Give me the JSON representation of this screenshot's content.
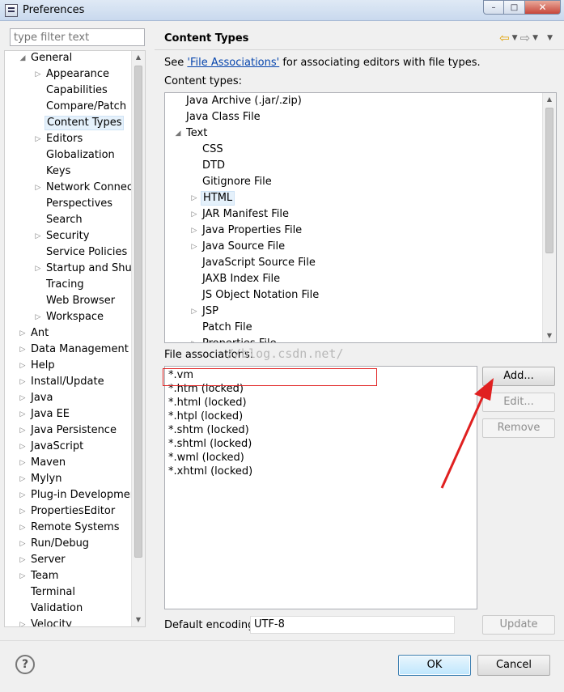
{
  "window": {
    "title": "Preferences",
    "minimize_glyph": "–",
    "maximize_glyph": "□",
    "close_glyph": "✕"
  },
  "filter": {
    "placeholder": "type filter text"
  },
  "left_tree": [
    {
      "label": "General",
      "level": 0,
      "arrow": "expanded"
    },
    {
      "label": "Appearance",
      "level": 1,
      "arrow": "collapsed"
    },
    {
      "label": "Capabilities",
      "level": 1,
      "arrow": "none"
    },
    {
      "label": "Compare/Patch",
      "level": 1,
      "arrow": "none"
    },
    {
      "label": "Content Types",
      "level": 1,
      "arrow": "none",
      "selected": true
    },
    {
      "label": "Editors",
      "level": 1,
      "arrow": "collapsed"
    },
    {
      "label": "Globalization",
      "level": 1,
      "arrow": "none"
    },
    {
      "label": "Keys",
      "level": 1,
      "arrow": "none"
    },
    {
      "label": "Network Connecti",
      "level": 1,
      "arrow": "collapsed"
    },
    {
      "label": "Perspectives",
      "level": 1,
      "arrow": "none"
    },
    {
      "label": "Search",
      "level": 1,
      "arrow": "none"
    },
    {
      "label": "Security",
      "level": 1,
      "arrow": "collapsed"
    },
    {
      "label": "Service Policies",
      "level": 1,
      "arrow": "none"
    },
    {
      "label": "Startup and Shutd",
      "level": 1,
      "arrow": "collapsed"
    },
    {
      "label": "Tracing",
      "level": 1,
      "arrow": "none"
    },
    {
      "label": "Web Browser",
      "level": 1,
      "arrow": "none"
    },
    {
      "label": "Workspace",
      "level": 1,
      "arrow": "collapsed"
    },
    {
      "label": "Ant",
      "level": 0,
      "arrow": "collapsed"
    },
    {
      "label": "Data Management",
      "level": 0,
      "arrow": "collapsed"
    },
    {
      "label": "Help",
      "level": 0,
      "arrow": "collapsed"
    },
    {
      "label": "Install/Update",
      "level": 0,
      "arrow": "collapsed"
    },
    {
      "label": "Java",
      "level": 0,
      "arrow": "collapsed"
    },
    {
      "label": "Java EE",
      "level": 0,
      "arrow": "collapsed"
    },
    {
      "label": "Java Persistence",
      "level": 0,
      "arrow": "collapsed"
    },
    {
      "label": "JavaScript",
      "level": 0,
      "arrow": "collapsed"
    },
    {
      "label": "Maven",
      "level": 0,
      "arrow": "collapsed"
    },
    {
      "label": "Mylyn",
      "level": 0,
      "arrow": "collapsed"
    },
    {
      "label": "Plug-in Development",
      "level": 0,
      "arrow": "collapsed"
    },
    {
      "label": "PropertiesEditor",
      "level": 0,
      "arrow": "collapsed"
    },
    {
      "label": "Remote Systems",
      "level": 0,
      "arrow": "collapsed"
    },
    {
      "label": "Run/Debug",
      "level": 0,
      "arrow": "collapsed"
    },
    {
      "label": "Server",
      "level": 0,
      "arrow": "collapsed"
    },
    {
      "label": "Team",
      "level": 0,
      "arrow": "collapsed"
    },
    {
      "label": "Terminal",
      "level": 0,
      "arrow": "none"
    },
    {
      "label": "Validation",
      "level": 0,
      "arrow": "none"
    },
    {
      "label": "Velocity",
      "level": 0,
      "arrow": "collapsed"
    }
  ],
  "page": {
    "title": "Content Types",
    "see_prefix": "See ",
    "see_link": "'File Associations'",
    "see_suffix": " for associating editors with file types.",
    "content_types_label": "Content types:",
    "file_assoc_label": "File associations:",
    "watermark": "//blog.csdn.net/",
    "encoding_label": "Default encoding:",
    "encoding_value": "UTF-8"
  },
  "content_types": [
    {
      "label": "Java Archive (.jar/.zip)",
      "level": 0,
      "arrow": "none"
    },
    {
      "label": "Java Class File",
      "level": 0,
      "arrow": "none"
    },
    {
      "label": "Text",
      "level": 0,
      "arrow": "expanded"
    },
    {
      "label": "CSS",
      "level": 1,
      "arrow": "none"
    },
    {
      "label": "DTD",
      "level": 1,
      "arrow": "none"
    },
    {
      "label": "Gitignore File",
      "level": 1,
      "arrow": "none"
    },
    {
      "label": "HTML",
      "level": 1,
      "arrow": "collapsed",
      "selected": true
    },
    {
      "label": "JAR Manifest File",
      "level": 1,
      "arrow": "collapsed"
    },
    {
      "label": "Java Properties File",
      "level": 1,
      "arrow": "collapsed"
    },
    {
      "label": "Java Source File",
      "level": 1,
      "arrow": "collapsed"
    },
    {
      "label": "JavaScript Source File",
      "level": 1,
      "arrow": "none"
    },
    {
      "label": "JAXB Index File",
      "level": 1,
      "arrow": "none"
    },
    {
      "label": "JS Object Notation File",
      "level": 1,
      "arrow": "none"
    },
    {
      "label": "JSP",
      "level": 1,
      "arrow": "collapsed"
    },
    {
      "label": "Patch File",
      "level": 1,
      "arrow": "none"
    },
    {
      "label": "Properties File",
      "level": 1,
      "arrow": "collapsed"
    }
  ],
  "file_associations": [
    "*.vm",
    "*.htm (locked)",
    "*.html (locked)",
    "*.htpl (locked)",
    "*.shtm (locked)",
    "*.shtml (locked)",
    "*.wml (locked)",
    "*.xhtml (locked)"
  ],
  "buttons": {
    "add": "Add...",
    "edit": "Edit...",
    "remove": "Remove",
    "update": "Update",
    "ok": "OK",
    "cancel": "Cancel",
    "help": "?"
  },
  "colors": {
    "annotation_red": "#e02020",
    "link": "#0645ad",
    "selection": "#e5f1fb"
  }
}
